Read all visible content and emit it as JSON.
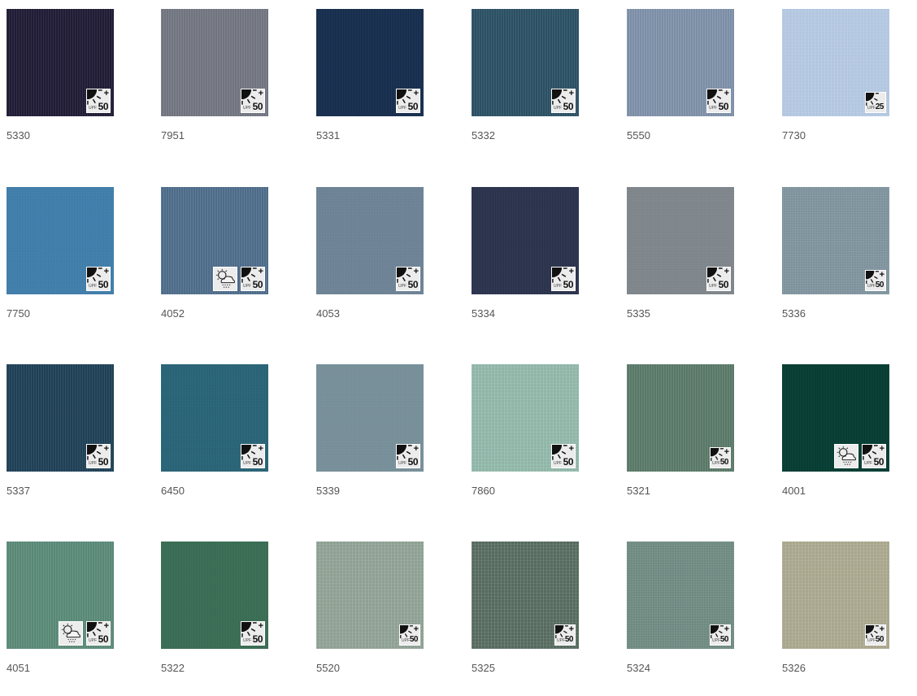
{
  "swatches": [
    {
      "code": "5330",
      "color": "#221e38",
      "texture": "weave-vertical",
      "badges": [
        {
          "type": "uv",
          "rating": "50",
          "plus": "+"
        }
      ]
    },
    {
      "code": "7951",
      "color": "#767a86",
      "texture": "weave-vertical",
      "badges": [
        {
          "type": "uv",
          "rating": "50",
          "plus": "+"
        }
      ]
    },
    {
      "code": "5331",
      "color": "#152c4d",
      "texture": "weave-fine",
      "badges": [
        {
          "type": "uv",
          "rating": "50",
          "plus": "+"
        }
      ]
    },
    {
      "code": "5332",
      "color": "#2e5468",
      "texture": "weave-vertical",
      "badges": [
        {
          "type": "uv",
          "rating": "50",
          "plus": "+"
        }
      ]
    },
    {
      "code": "5550",
      "color": "#8396ae",
      "texture": "weave-vertical",
      "badges": [
        {
          "type": "uv",
          "rating": "50",
          "plus": "+"
        }
      ]
    },
    {
      "code": "7730",
      "color": "#b2c6e0",
      "texture": "weave-grid",
      "badges": [
        {
          "type": "uv-small",
          "rating": "25",
          "plus": ""
        }
      ]
    },
    {
      "code": "7750",
      "color": "#3e7eac",
      "texture": "weave-fine",
      "badges": [
        {
          "type": "uv",
          "rating": "50",
          "plus": "+"
        }
      ]
    },
    {
      "code": "4052",
      "color": "#52718f",
      "texture": "weave-vertical",
      "badges": [
        {
          "type": "weather"
        },
        {
          "type": "uv",
          "rating": "50",
          "plus": "+"
        }
      ]
    },
    {
      "code": "4053",
      "color": "#6d8396",
      "texture": "weave-fine",
      "badges": [
        {
          "type": "uv",
          "rating": "50",
          "plus": "+"
        }
      ]
    },
    {
      "code": "5334",
      "color": "#29314c",
      "texture": "weave-fine",
      "badges": [
        {
          "type": "uv",
          "rating": "50",
          "plus": "+"
        }
      ]
    },
    {
      "code": "5335",
      "color": "#7f868c",
      "texture": "weave-fine",
      "badges": [
        {
          "type": "uv",
          "rating": "50",
          "plus": "+"
        }
      ]
    },
    {
      "code": "5336",
      "color": "#7d929c",
      "texture": "weave-dots",
      "badges": [
        {
          "type": "uv-small",
          "rating": "50",
          "plus": "+"
        }
      ]
    },
    {
      "code": "5337",
      "color": "#21435a",
      "texture": "weave-vertical",
      "badges": [
        {
          "type": "uv",
          "rating": "50",
          "plus": "+"
        }
      ]
    },
    {
      "code": "6450",
      "color": "#276377",
      "texture": "weave-fine",
      "badges": [
        {
          "type": "uv",
          "rating": "50",
          "plus": "+"
        }
      ]
    },
    {
      "code": "5339",
      "color": "#77909a",
      "texture": "weave-fine",
      "badges": [
        {
          "type": "uv",
          "rating": "50",
          "plus": "+"
        }
      ]
    },
    {
      "code": "7860",
      "color": "#8fb6a8",
      "texture": "weave-grid",
      "badges": [
        {
          "type": "uv",
          "rating": "50",
          "plus": "+"
        }
      ]
    },
    {
      "code": "5321",
      "color": "#5f7e6e",
      "texture": "weave-vertical",
      "badges": [
        {
          "type": "uv-small",
          "rating": "50",
          "plus": "+"
        }
      ]
    },
    {
      "code": "4001",
      "color": "#033b31",
      "texture": "weave-fine",
      "badges": [
        {
          "type": "weather"
        },
        {
          "type": "uv",
          "rating": "50",
          "plus": "+"
        }
      ]
    },
    {
      "code": "4051",
      "color": "#5f8f7c",
      "texture": "weave-vertical",
      "badges": [
        {
          "type": "weather"
        },
        {
          "type": "uv",
          "rating": "50",
          "plus": "+"
        }
      ]
    },
    {
      "code": "5322",
      "color": "#386c53",
      "texture": "weave-fine",
      "badges": [
        {
          "type": "uv",
          "rating": "50",
          "plus": "+"
        }
      ]
    },
    {
      "code": "5520",
      "color": "#8ea093",
      "texture": "weave-grid",
      "badges": [
        {
          "type": "uv-small",
          "rating": "50",
          "plus": "+"
        }
      ]
    },
    {
      "code": "5325",
      "color": "#566a5e",
      "texture": "weave-grid",
      "badges": [
        {
          "type": "uv-small",
          "rating": "50",
          "plus": "+"
        }
      ]
    },
    {
      "code": "5324",
      "color": "#6d8980",
      "texture": "weave-dots",
      "badges": [
        {
          "type": "uv-small",
          "rating": "50",
          "plus": "+"
        }
      ]
    },
    {
      "code": "5326",
      "color": "#a8a68c",
      "texture": "weave-grid",
      "badges": [
        {
          "type": "uv-small",
          "rating": "50",
          "plus": "+"
        }
      ]
    }
  ],
  "badge_text": {
    "upf": "UPF"
  }
}
